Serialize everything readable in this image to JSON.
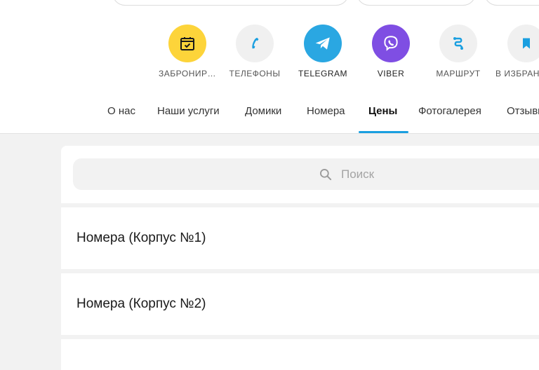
{
  "actions": [
    {
      "label": "ЗАБРОНИР…",
      "icon": "calendar-check-icon",
      "color": "#fdd43a"
    },
    {
      "label": "ТЕЛЕФОНЫ",
      "icon": "phone-icon",
      "color": "#f0f0f0"
    },
    {
      "label": "TELEGRAM",
      "icon": "telegram-icon",
      "color": "#2aa7e2"
    },
    {
      "label": "VIBER",
      "icon": "viber-icon",
      "color": "#7f4ee3"
    },
    {
      "label": "МАРШРУТ",
      "icon": "route-icon",
      "color": "#f0f0f0"
    },
    {
      "label": "В ИЗБРАННОЕ",
      "icon": "bookmark-icon",
      "color": "#f0f0f0"
    }
  ],
  "tabs": [
    {
      "label": "О нас"
    },
    {
      "label": "Наши услуги"
    },
    {
      "label": "Домики"
    },
    {
      "label": "Номера"
    },
    {
      "label": "Цены",
      "active": true
    },
    {
      "label": "Фотогалерея"
    },
    {
      "label": "Отзывы"
    }
  ],
  "search": {
    "placeholder": "Поиск"
  },
  "list": {
    "items": [
      {
        "label": "Номера (Корпус №1)"
      },
      {
        "label": "Номера (Корпус №2)"
      }
    ]
  },
  "colors": {
    "accent": "#1a9fe0",
    "icon_blue": "#1a9fe0"
  }
}
